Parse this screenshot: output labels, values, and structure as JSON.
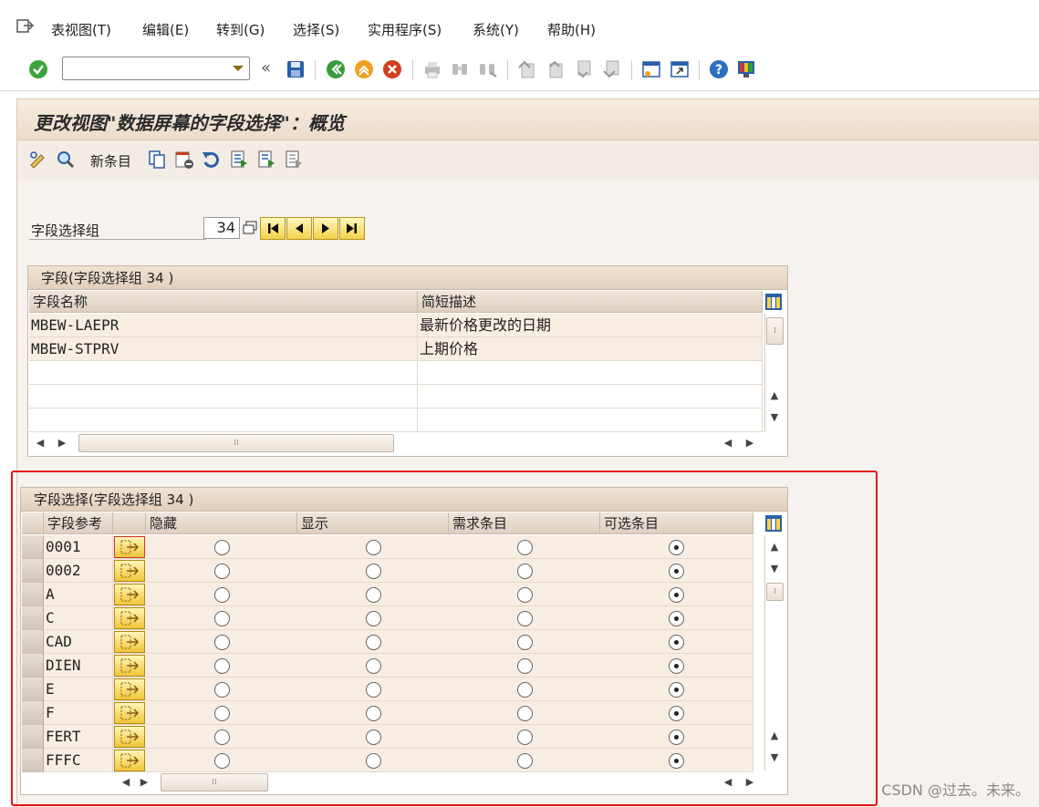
{
  "menubar": {
    "items": [
      "表视图(T)",
      "编辑(E)",
      "转到(G)",
      "选择(S)",
      "实用程序(S)",
      "系统(Y)",
      "帮助(H)"
    ]
  },
  "toolbar": {
    "command_field_value": ""
  },
  "title": "更改视图\"数据屏幕的字段选择\"：概览",
  "app_toolbar": {
    "new_entries_label": "新条目"
  },
  "group_selector": {
    "label": "字段选择组",
    "value": "34"
  },
  "fields_table": {
    "caption": "字段(字段选择组 34 )",
    "columns": [
      "字段名称",
      "简短描述"
    ],
    "rows": [
      {
        "name": "MBEW-LAEPR",
        "desc": "最新价格更改的日期"
      },
      {
        "name": "MBEW-STPRV",
        "desc": "上期价格"
      }
    ]
  },
  "selection_table": {
    "caption": "字段选择(字段选择组 34 )",
    "columns": [
      "字段参考",
      "隐藏",
      "显示",
      "需求条目",
      "可选条目"
    ],
    "rows": [
      {
        "ref": "0001",
        "selected": "可选条目"
      },
      {
        "ref": "0002",
        "selected": "可选条目"
      },
      {
        "ref": "A",
        "selected": "可选条目"
      },
      {
        "ref": "C",
        "selected": "可选条目"
      },
      {
        "ref": "CAD",
        "selected": "可选条目"
      },
      {
        "ref": "DIEN",
        "selected": "可选条目"
      },
      {
        "ref": "E",
        "selected": "可选条目"
      },
      {
        "ref": "F",
        "selected": "可选条目"
      },
      {
        "ref": "FERT",
        "selected": "可选条目"
      },
      {
        "ref": "FFFC",
        "selected": "可选条目"
      }
    ]
  },
  "watermark": "CSDN @过去。未来。",
  "colors": {
    "highlight_border": "#e21414",
    "title_bg": "#ecdccb",
    "detail_button": "#f0c63a"
  }
}
